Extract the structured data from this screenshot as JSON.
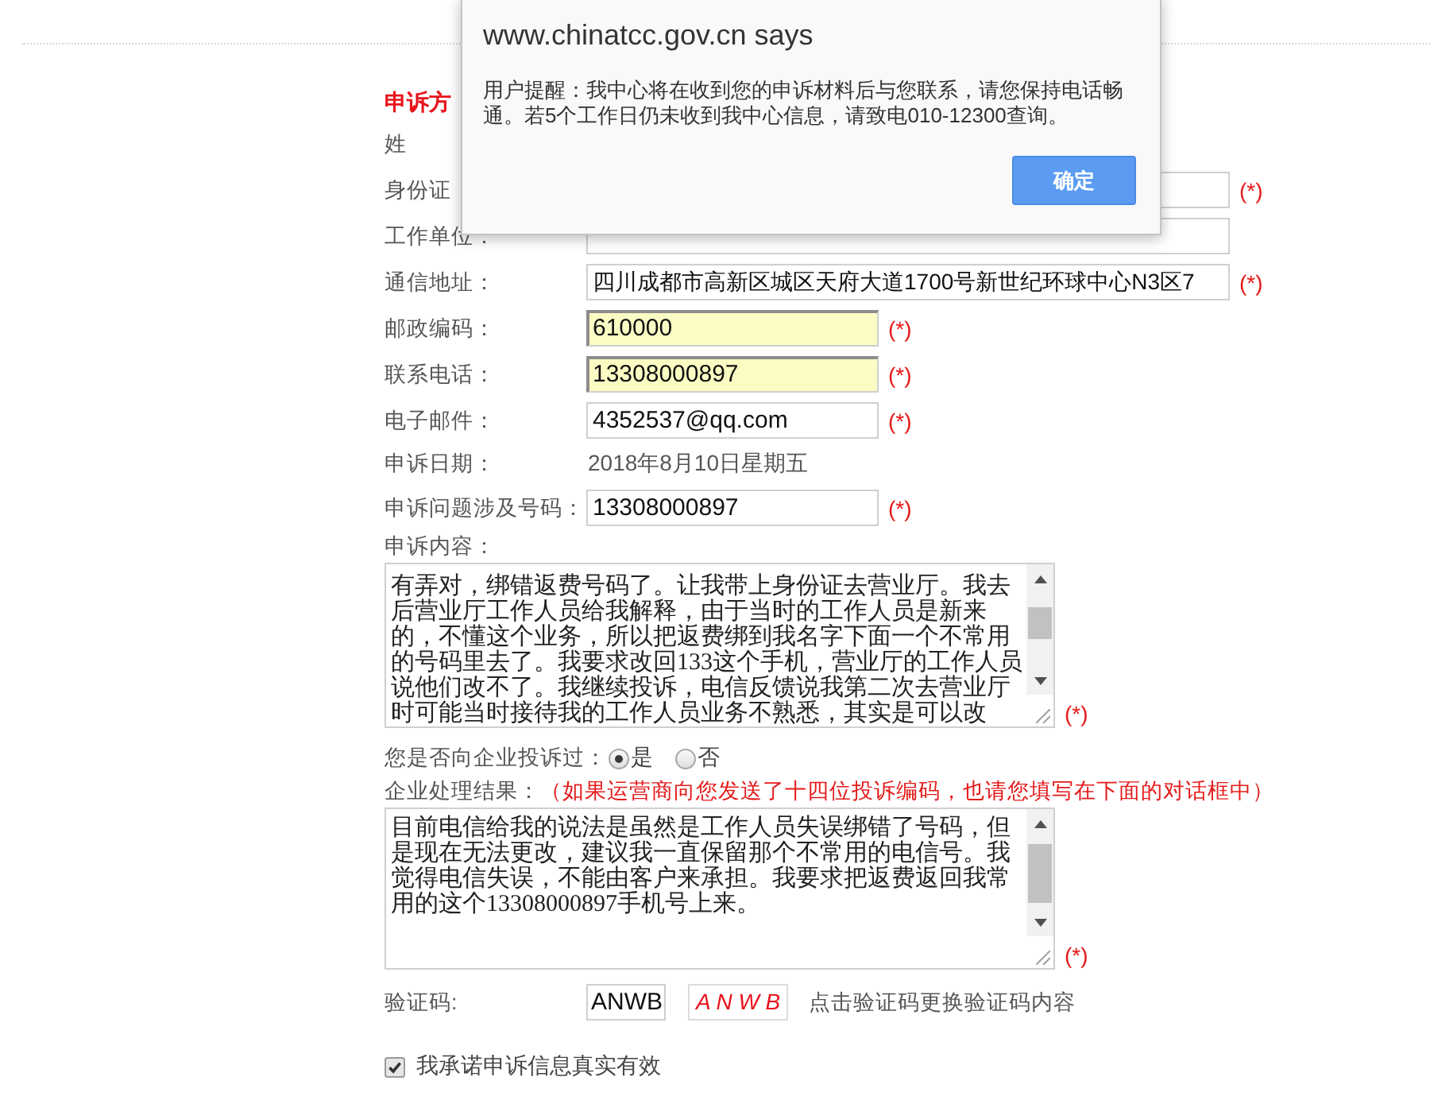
{
  "dialog": {
    "title": "www.chinatcc.gov.cn says",
    "message": "用户提醒：我中心将在收到您的申诉材料后与您联系，请您保持电话畅通。若5个工作日仍未收到我中心信息，请致电010-12300查询。",
    "button": "确定"
  },
  "form": {
    "section_title": "申诉方",
    "rows": [
      {
        "kind": "label",
        "label": "姓"
      },
      {
        "kind": "longtext",
        "label": "身份证",
        "autofilled": false,
        "mark": "(*)"
      },
      {
        "kind": "longtext",
        "label": "工作单位：",
        "autofilled": false
      },
      {
        "kind": "longtext",
        "label": "通信地址：",
        "value": "四川成都市高新区城区天府大道1700号新世纪环球中心N3区7",
        "autofilled": false,
        "mark": "(*)"
      },
      {
        "kind": "text",
        "label": "邮政编码：",
        "value": "610000",
        "autofilled": true,
        "mark": "(*)"
      },
      {
        "kind": "text",
        "label": "联系电话：",
        "value": "13308000897",
        "autofilled": true,
        "mark": "(*)"
      },
      {
        "kind": "text",
        "label": "电子邮件：",
        "value": "4352537@qq.com",
        "autofilled": false,
        "mark": "(*)"
      },
      {
        "kind": "static",
        "label": "申诉日期：",
        "value": "2018年8月10日星期五"
      },
      {
        "kind": "text",
        "label": "申诉问题涉及号码：",
        "value": "13308000897",
        "autofilled": false,
        "mark": "(*)"
      },
      {
        "kind": "textarea",
        "label": "申诉内容：",
        "value": "有弄对，绑错返费号码了。让我带上身份证去营业厅。我去后营业厅工作人员给我解释，由于当时的工作人员是新来的，不懂这个业务，所以把返费绑到我名字下面一个不常用的号码里去了。我要求改回133这个手机，营业厅的工作人员说他们改不了。我继续投诉，电信反馈说我第二次去营业厅时可能当时接待我的工作人员业务不熟悉，其实是可以改",
        "mark": "(*)"
      },
      {
        "kind": "radio",
        "label": "您是否向企业投诉过：",
        "options": [
          {
            "label": "是",
            "selected": true
          },
          {
            "label": "否",
            "selected": false
          }
        ]
      },
      {
        "kind": "textarea",
        "label": "企业处理结果：",
        "note": "（如果运营商向您发送了十四位投诉编码，也请您填写在下面的对话框中）",
        "value": "目前电信给我的说法是虽然是工作人员失误绑错了号码，但是现在无法更改，建议我一直保留那个不常用的电信号。我觉得电信失误，不能由客户来承担。我要求把返费返回我常用的这个13308000897手机号上来。",
        "mark": "(*)"
      },
      {
        "kind": "captcha",
        "label": "验证码:",
        "value": "ANWB",
        "captcha": "A N W B",
        "hint": "点击验证码更换验证码内容"
      },
      {
        "kind": "checkbox",
        "label": "我承诺申诉信息真实有效",
        "checked": true
      }
    ]
  }
}
